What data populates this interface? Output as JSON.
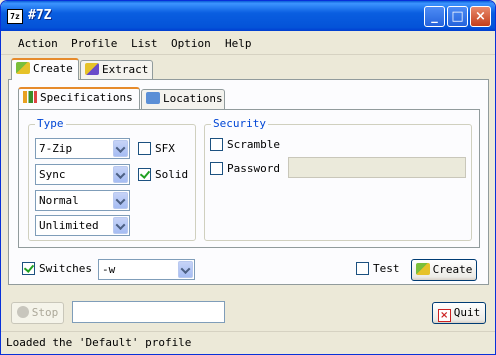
{
  "window": {
    "icon_text": "7z",
    "title": "#7Z",
    "buttons": {
      "minimize": "_",
      "maximize": "□",
      "close": "×"
    }
  },
  "menu": [
    "Action",
    "Profile",
    "List",
    "Option",
    "Help"
  ],
  "tabs": {
    "create": "Create",
    "extract": "Extract"
  },
  "subtabs": {
    "specifications": "Specifications",
    "locations": "Locations"
  },
  "type_group": {
    "legend": "Type",
    "format": "7-Zip",
    "mode": "Sync",
    "level": "Normal",
    "volume": "Unlimited",
    "sfx": {
      "label": "SFX",
      "checked": false
    },
    "solid": {
      "label": "Solid",
      "checked": true
    }
  },
  "security_group": {
    "legend": "Security",
    "scramble": {
      "label": "Scramble",
      "checked": false
    },
    "password": {
      "label": "Password",
      "checked": false,
      "value": ""
    }
  },
  "switches": {
    "label": "Switches",
    "checked": true,
    "value": "-w"
  },
  "test": {
    "label": "Test",
    "checked": false
  },
  "create_button": "Create",
  "stop_button": "Stop",
  "progress_field": "",
  "quit_button": "Quit",
  "status_text": "Loaded the 'Default' profile",
  "colors": {
    "title_bar": "#0a5ee0",
    "accent_tab": "#e68b2c",
    "legend": "#0046d5",
    "check": "#21a121"
  }
}
